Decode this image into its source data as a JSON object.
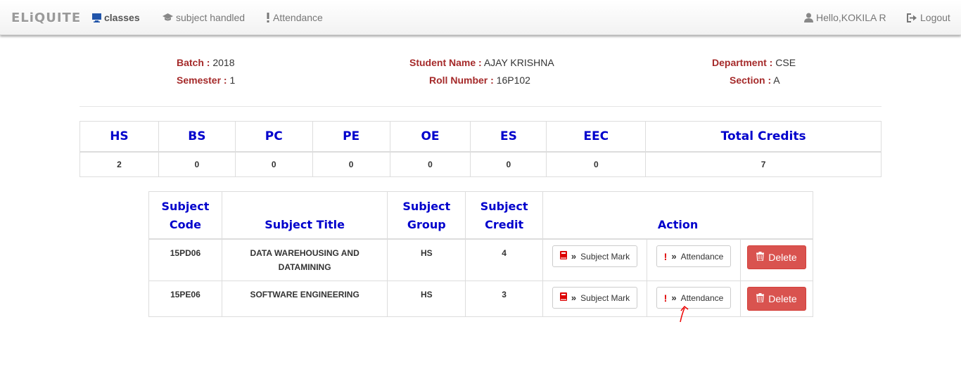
{
  "navbar": {
    "brand": "ELiQUITE",
    "items": [
      {
        "label": "classes",
        "icon": "monitor-icon"
      },
      {
        "label": "subject handled",
        "icon": "graduation-cap-icon"
      },
      {
        "label": "Attendance",
        "icon": "exclamation-icon"
      }
    ],
    "user_greeting": "Hello,KOKILA R",
    "logout_label": "Logout"
  },
  "student": {
    "batch_label": "Batch :",
    "batch": "2018",
    "semester_label": "Semester :",
    "semester": "1",
    "name_label": "Student Name :",
    "name": "AJAY KRISHNA",
    "roll_label": "Roll Number :",
    "roll": "16P102",
    "department_label": "Department :",
    "department": "CSE",
    "section_label": "Section :",
    "section": "A"
  },
  "credits": {
    "headers": [
      "HS",
      "BS",
      "PC",
      "PE",
      "OE",
      "ES",
      "EEC",
      "Total Credits"
    ],
    "values": [
      "2",
      "0",
      "0",
      "0",
      "0",
      "0",
      "0",
      "7"
    ]
  },
  "subjects": {
    "headers": {
      "code_line1": "Subject",
      "code_line2": "Code",
      "title": "Subject Title",
      "group_line1": "Subject",
      "group_line2": "Group",
      "credit_line1": "Subject",
      "credit_line2": "Credit",
      "action": "Action"
    },
    "rows": [
      {
        "code": "15PD06",
        "title": "DATA WAREHOUSING AND DATAMINING",
        "group": "HS",
        "credit": "4"
      },
      {
        "code": "15PE06",
        "title": "SOFTWARE ENGINEERING",
        "group": "HS",
        "credit": "3"
      }
    ],
    "buttons": {
      "mark": "Subject Mark",
      "attendance": "Attendance",
      "delete": "Delete"
    }
  },
  "colors": {
    "label_red": "#a52a2a",
    "header_blue": "#0000cc",
    "delete_red": "#d9534f"
  }
}
